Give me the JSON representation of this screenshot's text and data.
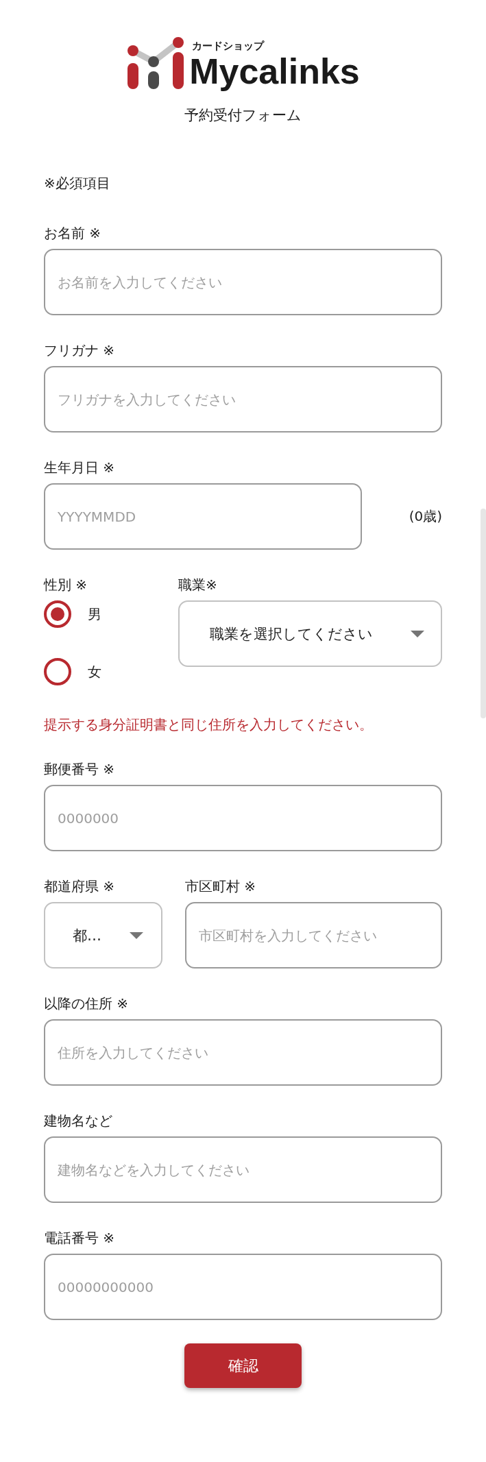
{
  "header": {
    "tagline": "カードショップ",
    "brand": "Mycalinks",
    "subtitle": "予約受付フォーム"
  },
  "required_note": "※必須項目",
  "name_field": {
    "label": "お名前 ※",
    "placeholder": "お名前を入力してください"
  },
  "furigana_field": {
    "label": "フリガナ ※",
    "placeholder": "フリガナを入力してください"
  },
  "birthdate_field": {
    "label": "生年月日 ※",
    "placeholder": "YYYYMMDD",
    "age": "(0歳)"
  },
  "gender": {
    "label": "性別 ※",
    "options": [
      {
        "label": "男",
        "selected": true
      },
      {
        "label": "女",
        "selected": false
      }
    ]
  },
  "occupation": {
    "label": "職業※",
    "value": "職業を選択してください"
  },
  "address_note": "提示する身分証明書と同じ住所を入力してください。",
  "postal_code_field": {
    "label": "郵便番号 ※",
    "placeholder": "0000000"
  },
  "prefecture": {
    "label": "都道府県 ※",
    "value": "都…"
  },
  "city_field": {
    "label": "市区町村 ※",
    "placeholder": "市区町村を入力してください"
  },
  "address_field": {
    "label": "以降の住所 ※",
    "placeholder": "住所を入力してください"
  },
  "building_field": {
    "label": "建物名など",
    "placeholder": "建物名などを入力してください"
  },
  "phone_field": {
    "label": "電話番号 ※",
    "placeholder": "00000000000"
  },
  "submit_button": "確認"
}
